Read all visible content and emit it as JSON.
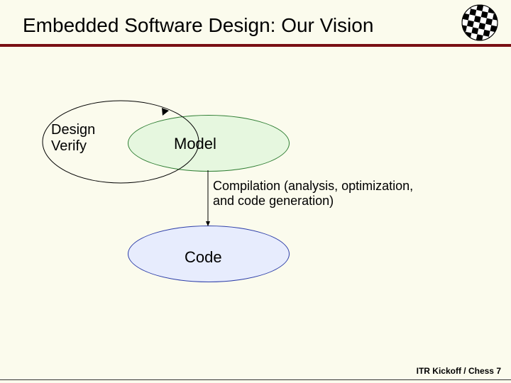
{
  "title": "Embedded Software Design:  Our Vision",
  "footer": "ITR Kickoff / Chess 7",
  "diagram": {
    "design_verify": "Design\nVerify",
    "model": "Model",
    "compilation": "Compilation (analysis, optimization,\nand code generation)",
    "code": "Code"
  },
  "colors": {
    "rule": "#7a0f14",
    "model_fill": "#e6f7df",
    "model_stroke": "#2e7d32",
    "code_fill": "#e7ecfd",
    "code_stroke": "#2c3da8",
    "background": "#fbfbed"
  }
}
